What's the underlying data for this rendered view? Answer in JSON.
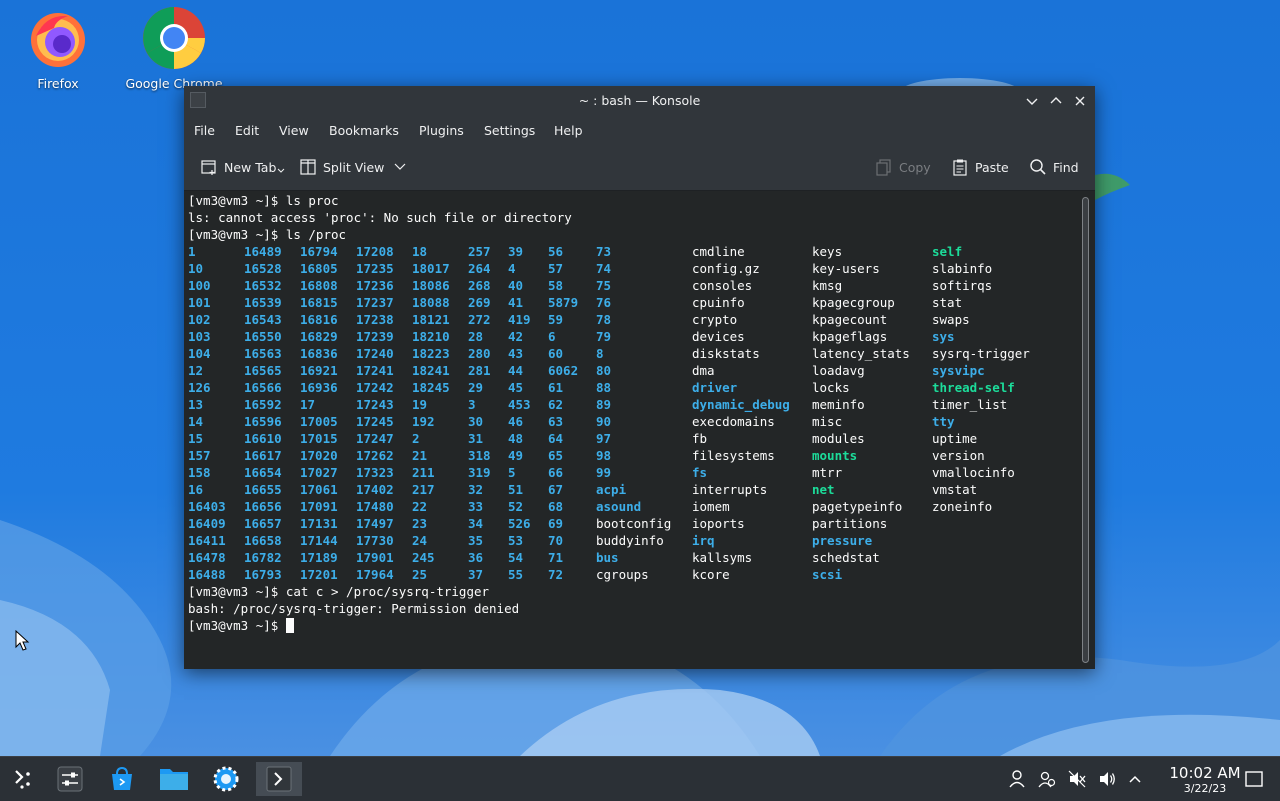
{
  "desktop": {
    "icons": [
      {
        "label": "Firefox",
        "icon": "firefox-icon"
      },
      {
        "label": "Google Chrome",
        "icon": "chrome-icon"
      }
    ]
  },
  "window": {
    "title": "~ : bash — Konsole",
    "controls": [
      "minimize-icon",
      "maximize-icon",
      "close-icon"
    ]
  },
  "menubar": [
    "File",
    "Edit",
    "View",
    "Bookmarks",
    "Plugins",
    "Settings",
    "Help"
  ],
  "toolbar": {
    "new_tab": "New Tab",
    "split_view": "Split View",
    "copy": "Copy",
    "paste": "Paste",
    "find": "Find"
  },
  "terminal": {
    "lines_before": [
      "[vm3@vm3 ~]$ ls proc",
      "ls: cannot access 'proc': No such file or directory",
      "[vm3@vm3 ~]$ ls /proc"
    ],
    "listing": {
      "col1": [
        "1",
        "10",
        "100",
        "101",
        "102",
        "103",
        "104",
        "12",
        "126",
        "13",
        "14",
        "15",
        "157",
        "158",
        "16",
        "16403",
        "16409",
        "16411",
        "16478",
        "16488"
      ],
      "col2": [
        "16489",
        "16528",
        "16532",
        "16539",
        "16543",
        "16550",
        "16563",
        "16565",
        "16566",
        "16592",
        "16596",
        "16610",
        "16617",
        "16654",
        "16655",
        "16656",
        "16657",
        "16658",
        "16782",
        "16793"
      ],
      "col3": [
        "16794",
        "16805",
        "16808",
        "16815",
        "16816",
        "16829",
        "16836",
        "16921",
        "16936",
        "17",
        "17005",
        "17015",
        "17020",
        "17027",
        "17061",
        "17091",
        "17131",
        "17144",
        "17189",
        "17201"
      ],
      "col4": [
        "17208",
        "17235",
        "17236",
        "17237",
        "17238",
        "17239",
        "17240",
        "17241",
        "17242",
        "17243",
        "17245",
        "17247",
        "17262",
        "17323",
        "17402",
        "17480",
        "17497",
        "17730",
        "17901",
        "17964"
      ],
      "col5": [
        "18",
        "18017",
        "18086",
        "18088",
        "18121",
        "18210",
        "18223",
        "18241",
        "18245",
        "19",
        "192",
        "2",
        "21",
        "211",
        "217",
        "22",
        "23",
        "24",
        "245",
        "25"
      ],
      "col6": [
        "257",
        "264",
        "268",
        "269",
        "272",
        "28",
        "280",
        "281",
        "29",
        "3",
        "30",
        "31",
        "318",
        "319",
        "32",
        "33",
        "34",
        "35",
        "36",
        "37"
      ],
      "col7": [
        "39",
        "4",
        "40",
        "41",
        "419",
        "42",
        "43",
        "44",
        "45",
        "453",
        "46",
        "48",
        "49",
        "5",
        "51",
        "52",
        "526",
        "53",
        "54",
        "55"
      ],
      "col8": [
        "56",
        "57",
        "58",
        "5879",
        "59",
        "6",
        "60",
        "6062",
        "61",
        "62",
        "63",
        "64",
        "65",
        "66",
        "67",
        "68",
        "69",
        "70",
        "71",
        "72"
      ],
      "col9": [
        {
          "t": "73",
          "k": "dir"
        },
        {
          "t": "74",
          "k": "dir"
        },
        {
          "t": "75",
          "k": "dir"
        },
        {
          "t": "76",
          "k": "dir"
        },
        {
          "t": "78",
          "k": "dir"
        },
        {
          "t": "79",
          "k": "dir"
        },
        {
          "t": "8",
          "k": "dir"
        },
        {
          "t": "80",
          "k": "dir"
        },
        {
          "t": "88",
          "k": "dir"
        },
        {
          "t": "89",
          "k": "dir"
        },
        {
          "t": "90",
          "k": "dir"
        },
        {
          "t": "97",
          "k": "dir"
        },
        {
          "t": "98",
          "k": "dir"
        },
        {
          "t": "99",
          "k": "dir"
        },
        {
          "t": "acpi",
          "k": "dir"
        },
        {
          "t": "asound",
          "k": "dir"
        },
        {
          "t": "bootconfig",
          "k": "plain"
        },
        {
          "t": "buddyinfo",
          "k": "plain"
        },
        {
          "t": "bus",
          "k": "dir"
        },
        {
          "t": "cgroups",
          "k": "plain"
        }
      ],
      "col10": [
        {
          "t": "cmdline",
          "k": "plain"
        },
        {
          "t": "config.gz",
          "k": "plain"
        },
        {
          "t": "consoles",
          "k": "plain"
        },
        {
          "t": "cpuinfo",
          "k": "plain"
        },
        {
          "t": "crypto",
          "k": "plain"
        },
        {
          "t": "devices",
          "k": "plain"
        },
        {
          "t": "diskstats",
          "k": "plain"
        },
        {
          "t": "dma",
          "k": "plain"
        },
        {
          "t": "driver",
          "k": "dir"
        },
        {
          "t": "dynamic_debug",
          "k": "dir"
        },
        {
          "t": "execdomains",
          "k": "plain"
        },
        {
          "t": "fb",
          "k": "plain"
        },
        {
          "t": "filesystems",
          "k": "plain"
        },
        {
          "t": "fs",
          "k": "dir"
        },
        {
          "t": "interrupts",
          "k": "plain"
        },
        {
          "t": "iomem",
          "k": "plain"
        },
        {
          "t": "ioports",
          "k": "plain"
        },
        {
          "t": "irq",
          "k": "dir"
        },
        {
          "t": "kallsyms",
          "k": "plain"
        },
        {
          "t": "kcore",
          "k": "plain"
        }
      ],
      "col11": [
        {
          "t": "keys",
          "k": "plain"
        },
        {
          "t": "key-users",
          "k": "plain"
        },
        {
          "t": "kmsg",
          "k": "plain"
        },
        {
          "t": "kpagecgroup",
          "k": "plain"
        },
        {
          "t": "kpagecount",
          "k": "plain"
        },
        {
          "t": "kpageflags",
          "k": "plain"
        },
        {
          "t": "latency_stats",
          "k": "plain"
        },
        {
          "t": "loadavg",
          "k": "plain"
        },
        {
          "t": "locks",
          "k": "plain"
        },
        {
          "t": "meminfo",
          "k": "plain"
        },
        {
          "t": "misc",
          "k": "plain"
        },
        {
          "t": "modules",
          "k": "plain"
        },
        {
          "t": "mounts",
          "k": "sym"
        },
        {
          "t": "mtrr",
          "k": "plain"
        },
        {
          "t": "net",
          "k": "sym"
        },
        {
          "t": "pagetypeinfo",
          "k": "plain"
        },
        {
          "t": "partitions",
          "k": "plain"
        },
        {
          "t": "pressure",
          "k": "dir"
        },
        {
          "t": "schedstat",
          "k": "plain"
        },
        {
          "t": "scsi",
          "k": "dir"
        }
      ],
      "col12": [
        {
          "t": "self",
          "k": "sym"
        },
        {
          "t": "slabinfo",
          "k": "plain"
        },
        {
          "t": "softirqs",
          "k": "plain"
        },
        {
          "t": "stat",
          "k": "plain"
        },
        {
          "t": "swaps",
          "k": "plain"
        },
        {
          "t": "sys",
          "k": "dir"
        },
        {
          "t": "sysrq-trigger",
          "k": "plain"
        },
        {
          "t": "sysvipc",
          "k": "dir"
        },
        {
          "t": "thread-self",
          "k": "sym"
        },
        {
          "t": "timer_list",
          "k": "plain"
        },
        {
          "t": "tty",
          "k": "dir"
        },
        {
          "t": "uptime",
          "k": "plain"
        },
        {
          "t": "version",
          "k": "plain"
        },
        {
          "t": "vmallocinfo",
          "k": "plain"
        },
        {
          "t": "vmstat",
          "k": "plain"
        },
        {
          "t": "zoneinfo",
          "k": "plain"
        }
      ]
    },
    "lines_after": [
      "[vm3@vm3 ~]$ cat c > /proc/sysrq-trigger",
      "bash: /proc/sysrq-trigger: Permission denied",
      "[vm3@vm3 ~]$ "
    ],
    "colors": {
      "directory": "#3daee9",
      "symlink": "#1cdc9a",
      "text": "#fcfcfc",
      "background": "#232627"
    }
  },
  "taskbar": {
    "launchers": [
      "application-launcher-icon",
      "system-settings-icon",
      "discover-icon",
      "file-manager-icon",
      "system-settings-gear-icon",
      "konsole-icon"
    ],
    "tray": [
      "user-icon",
      "users-icon",
      "audio-muted-icon",
      "volume-icon",
      "tray-expand-icon"
    ],
    "clock": {
      "time": "10:02 AM",
      "date": "3/22/23"
    },
    "show_desktop": "show-desktop-icon"
  }
}
